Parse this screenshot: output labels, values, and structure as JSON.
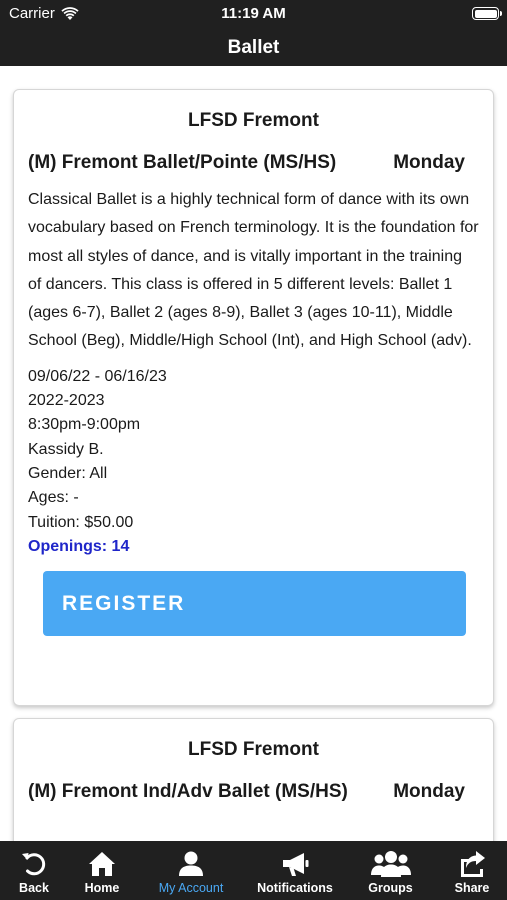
{
  "status_bar": {
    "carrier": "Carrier",
    "time": "11:19 AM"
  },
  "nav": {
    "title": "Ballet"
  },
  "classes": [
    {
      "location": "LFSD Fremont",
      "title": "(M) Fremont Ballet/Pointe (MS/HS)",
      "day": "Monday",
      "description": "Classical Ballet is a highly technical form of dance with its own vocabulary based on French terminology. It is the foundation for most all styles of dance, and is vitally important in the training of dancers. This class is offered in 5 different levels: Ballet 1 (ages 6-7), Ballet 2 (ages 8-9), Ballet 3 (ages 10-11), Middle School (Beg), Middle/High School (Int), and High School (adv).",
      "dates": "09/06/22 - 06/16/23",
      "season": "2022-2023",
      "time": "8:30pm-9:00pm",
      "instructor": "Kassidy B.",
      "gender": "Gender: All",
      "ages": "Ages: -",
      "tuition": "Tuition: $50.00",
      "openings": "Openings: 14",
      "register_label": "REGISTER"
    },
    {
      "location": "LFSD Fremont",
      "title": "(M) Fremont Ind/Adv Ballet (MS/HS)",
      "day": "Monday"
    }
  ],
  "tab_bar": {
    "active_color": "#4aa8f3",
    "tabs": [
      {
        "label": "Back",
        "icon": "back-arrow-icon"
      },
      {
        "label": "Home",
        "icon": "home-icon"
      },
      {
        "label": "My Account",
        "icon": "user-icon"
      },
      {
        "label": "Notifications",
        "icon": "megaphone-icon"
      },
      {
        "label": "Groups",
        "icon": "group-icon"
      },
      {
        "label": "Share",
        "icon": "share-icon"
      }
    ]
  }
}
